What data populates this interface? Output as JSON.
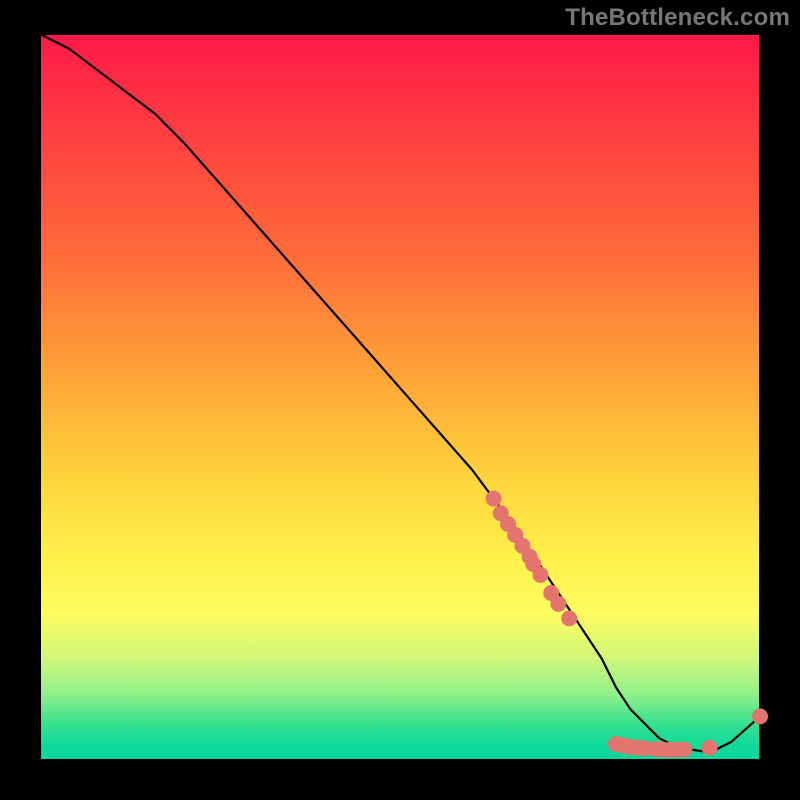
{
  "attribution": "TheBottleneck.com",
  "colors": {
    "gradient_top": "#ff1848",
    "gradient_mid": "#ffd63d",
    "gradient_bottom": "#0bd59d",
    "dot": "#e3746e",
    "line": "#000000",
    "page_bg": "#000000"
  },
  "chart_data": {
    "type": "line",
    "title": "",
    "xlabel": "",
    "ylabel": "",
    "xlim": [
      0,
      100
    ],
    "ylim": [
      0,
      100
    ],
    "annotations": [],
    "legend": false,
    "grid": false,
    "series": [
      {
        "name": "bottleneck-curve",
        "x": [
          0,
          4,
          8,
          12,
          16,
          20,
          28,
          36,
          44,
          52,
          60,
          66,
          70,
          74,
          78,
          80,
          82,
          84,
          86,
          88,
          90,
          92,
          94,
          96,
          100
        ],
        "y": [
          100,
          98,
          95,
          92,
          89,
          85,
          76,
          67,
          58,
          49,
          40,
          32,
          26,
          20,
          14,
          10,
          7,
          5,
          3,
          2,
          1.5,
          1.2,
          1.5,
          2.5,
          6
        ]
      }
    ],
    "points": {
      "name": "highlighted-samples",
      "color": "#e3746e",
      "x": [
        63,
        64,
        65,
        66,
        67,
        68,
        68.5,
        69.5,
        71,
        72,
        73.5,
        80,
        81,
        82,
        83,
        84,
        85.5,
        86.5,
        87.5,
        88.5,
        89.5,
        93,
        100
      ],
      "y": [
        36,
        34,
        32.5,
        31,
        29.5,
        28,
        27,
        25.5,
        23,
        21.5,
        19.5,
        2.2,
        2.0,
        1.8,
        1.7,
        1.6,
        1.5,
        1.45,
        1.4,
        1.4,
        1.45,
        1.7,
        6
      ]
    }
  }
}
